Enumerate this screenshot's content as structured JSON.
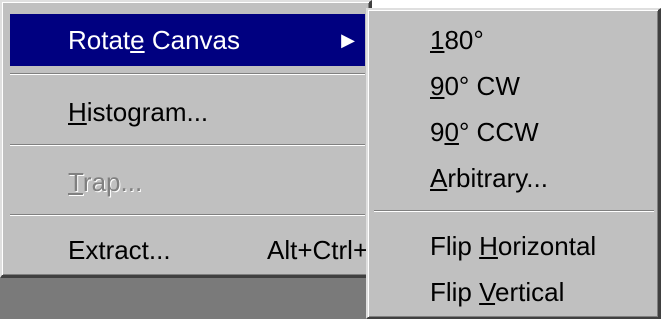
{
  "menu": {
    "items": [
      {
        "pre": "Rotat",
        "key": "e",
        "post": " Canvas",
        "has_submenu": true
      },
      {
        "pre": "",
        "key": "H",
        "post": "istogram...",
        "has_submenu": false
      },
      {
        "pre": "",
        "key": "T",
        "post": "rap...",
        "disabled": true
      },
      {
        "pre": "Extract...",
        "key": "",
        "post": "",
        "shortcut": "Alt+Ctrl+X"
      }
    ],
    "submenu_arrow": "▶"
  },
  "submenu": {
    "items": [
      {
        "pre": "",
        "key": "1",
        "post": "80°"
      },
      {
        "pre": "",
        "key": "9",
        "post": "0° CW"
      },
      {
        "pre": "9",
        "key": "0",
        "post": "° CCW"
      },
      {
        "pre": "",
        "key": "A",
        "post": "rbitrary..."
      },
      {
        "pre": "Flip ",
        "key": "H",
        "post": "orizontal"
      },
      {
        "pre": "Flip ",
        "key": "V",
        "post": "ertical"
      }
    ]
  },
  "colors": {
    "menu_bg": "#c0c0c0",
    "highlight": "#000080",
    "disabled_text": "#808080"
  }
}
